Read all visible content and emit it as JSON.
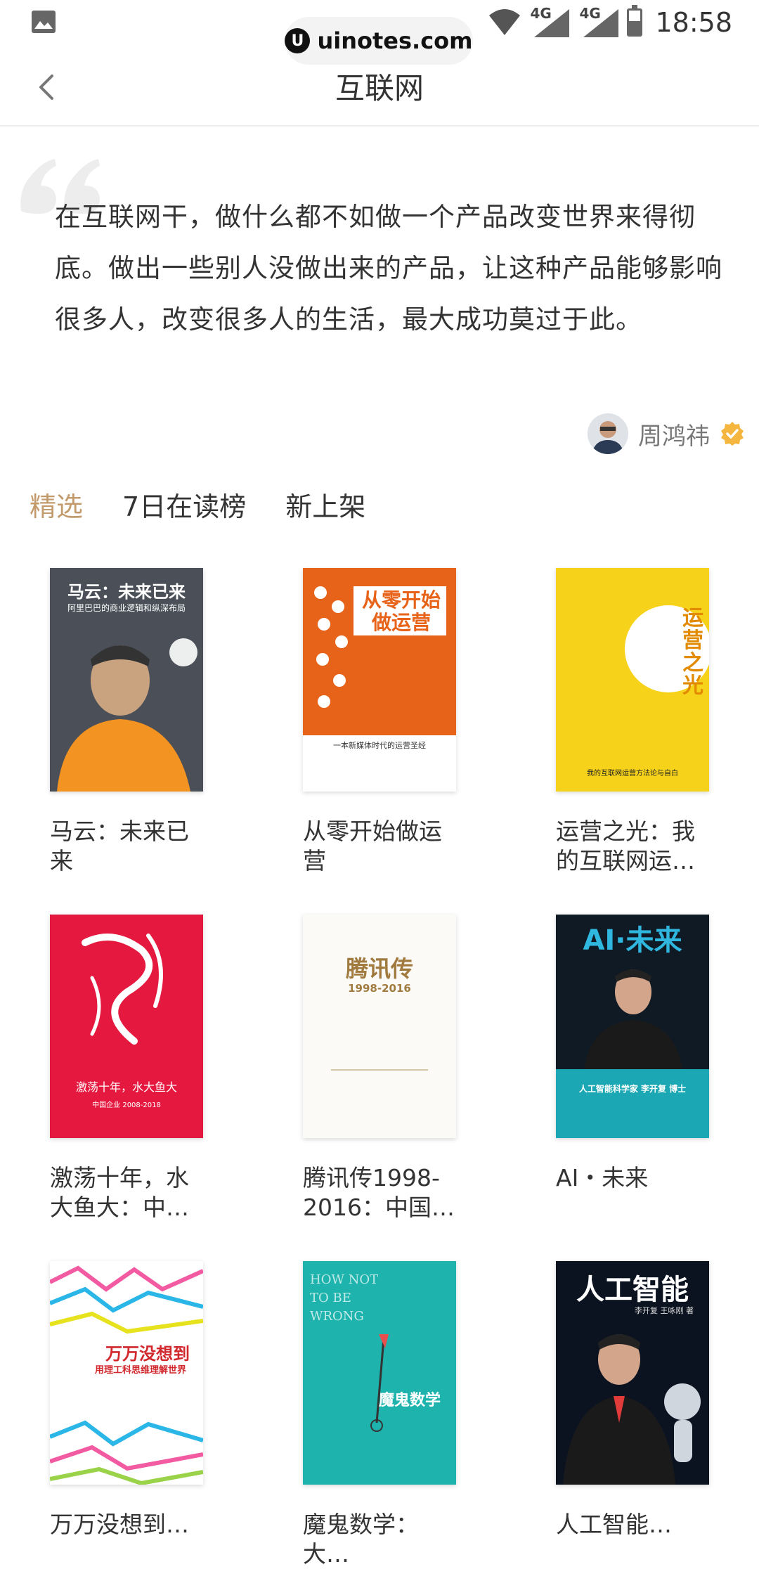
{
  "status_bar": {
    "network_1": "4G",
    "network_2": "4G",
    "time": "18:58"
  },
  "watermark": {
    "logo": "U",
    "text": "uinotes.com"
  },
  "header": {
    "title": "互联网",
    "back_icon": "chevron-left-icon"
  },
  "quote": {
    "text": "在互联网干，做什么都不如做一个产品改变世界来得彻底。做出一些别人没做出来的产品，让这种产品能够影响很多人，改变很多人的生活，最大成功莫过于此。",
    "author": "周鸿祎",
    "verified_color": "#f5b63f"
  },
  "tabs": [
    {
      "label": "精选",
      "active": true
    },
    {
      "label": "7日在读榜",
      "active": false
    },
    {
      "label": "新上架",
      "active": false
    }
  ],
  "accent_color": "#c39a6b",
  "books": [
    {
      "title": "马云：未来已来",
      "cover_title": "马云：未来已来",
      "cover_sub": "阿里巴巴的商业逻辑和纵深布局",
      "cover_color": "#4a4f58"
    },
    {
      "title": "从零开始做运营",
      "cover_title": "从零开始做运营",
      "cover_sub": "一本新媒体时代的运营圣经",
      "cover_color": "#e8631a"
    },
    {
      "title": "运营之光：我的互联网运…",
      "cover_title": "运营之光",
      "cover_sub": "我的互联网运营方法论与自白",
      "cover_color": "#f7d21a"
    },
    {
      "title": "激荡十年，水大鱼大：中…",
      "cover_title": "激荡十年，水大鱼大",
      "cover_sub": "中国企业 2008-2018",
      "cover_color": "#e5193f"
    },
    {
      "title": "腾讯传1998-2016：中国…",
      "cover_title": "腾讯传",
      "cover_sub": "1998-2016",
      "cover_color": "#fbfaf7"
    },
    {
      "title": "AI・未来",
      "cover_title": "AI·未来",
      "cover_sub": "人工智能科学家 李开复 博士",
      "cover_color": "#0f1a24"
    },
    {
      "title": "万万没想到…",
      "cover_title": "万万没想到",
      "cover_sub": "用理工科思维理解世界",
      "cover_color": "#ffffff"
    },
    {
      "title": "魔鬼数学：大…",
      "cover_title": "魔鬼数学",
      "cover_sub": "HOW NOT TO BE WRONG",
      "cover_color": "#1fb3ad"
    },
    {
      "title": "人工智能…",
      "cover_title": "人工智能",
      "cover_sub": "李开复 王咏刚 著",
      "cover_color": "#0b1320"
    }
  ]
}
